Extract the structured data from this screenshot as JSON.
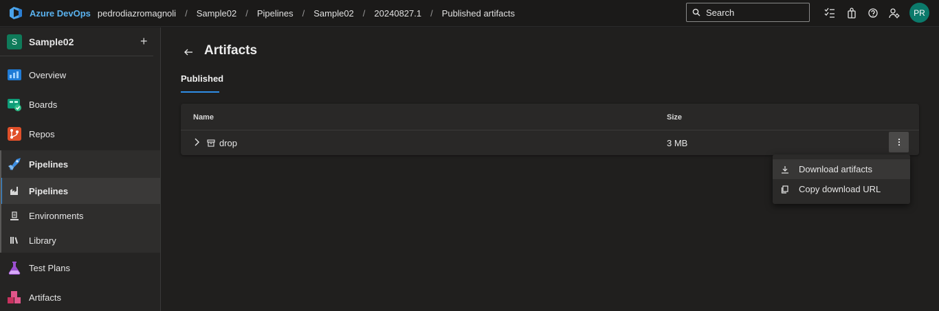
{
  "header": {
    "brand": "Azure DevOps",
    "breadcrumbs": [
      "pedrodiazromagnoli",
      "Sample02",
      "Pipelines",
      "Sample02",
      "20240827.1",
      "Published artifacts"
    ],
    "search_placeholder": "Search",
    "avatar_initials": "PR",
    "icons": [
      "azure-devops-logo",
      "search-icon",
      "task-list-icon",
      "shopping-bag-icon",
      "help-icon",
      "user-settings-icon"
    ]
  },
  "sidebar": {
    "project_initial": "S",
    "project_name": "Sample02",
    "add_label": "+",
    "items": [
      {
        "label": "Overview",
        "icon": "overview-icon"
      },
      {
        "label": "Boards",
        "icon": "boards-icon"
      },
      {
        "label": "Repos",
        "icon": "repos-icon"
      },
      {
        "label": "Pipelines",
        "icon": "pipelines-icon"
      },
      {
        "label": "Pipelines",
        "icon": "pipelines-sub-icon"
      },
      {
        "label": "Environments",
        "icon": "environments-icon"
      },
      {
        "label": "Library",
        "icon": "library-icon"
      },
      {
        "label": "Test Plans",
        "icon": "test-plans-icon"
      },
      {
        "label": "Artifacts",
        "icon": "artifacts-icon"
      }
    ],
    "selected": "Pipelines"
  },
  "main": {
    "title": "Artifacts",
    "tabs": [
      {
        "label": "Published",
        "active": true
      }
    ],
    "table": {
      "columns": [
        "Name",
        "Size"
      ],
      "rows": [
        {
          "name": "drop",
          "size": "3 MB"
        }
      ]
    },
    "context_menu": {
      "items": [
        {
          "label": "Download artifacts",
          "icon": "download-icon"
        },
        {
          "label": "Copy download URL",
          "icon": "copy-icon"
        }
      ]
    }
  },
  "colors": {
    "accent": "#2f8fe8",
    "brand_text": "#5ab3f0",
    "avatar_bg": "#0b7a6b",
    "project_badge": "#0f7b5a"
  }
}
